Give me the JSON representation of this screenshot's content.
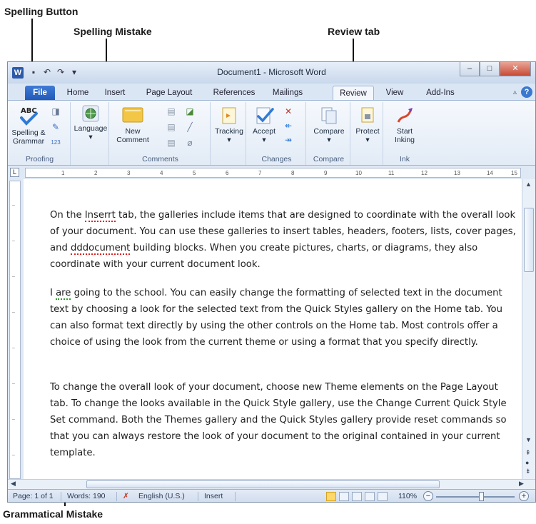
{
  "callouts": {
    "spelling_button": "Spelling Button",
    "spelling_mistake": "Spelling Mistake",
    "review_tab": "Review tab",
    "grammatical_mistake": "Grammatical Mistake"
  },
  "window": {
    "app_icon_letter": "W",
    "title": "Document1 - Microsoft Word"
  },
  "tabs": [
    "File",
    "Home",
    "Insert",
    "Page Layout",
    "References",
    "Mailings",
    "Review",
    "View",
    "Add-Ins"
  ],
  "active_tab": "Review",
  "ribbon": {
    "proofing": {
      "spelling_line1": "Spelling &",
      "spelling_line2": "Grammar",
      "group_label": "Proofing"
    },
    "language": {
      "label": "Language",
      "dropdown": "▾"
    },
    "comments": {
      "new_comment_line1": "New",
      "new_comment_line2": "Comment",
      "group_label": "Comments"
    },
    "tracking": {
      "label": "Tracking",
      "dropdown": "▾"
    },
    "changes": {
      "accept_label": "Accept",
      "dropdown": "▾",
      "group_label": "Changes"
    },
    "compare": {
      "compare_label": "Compare",
      "dropdown": "▾",
      "group_label": "Compare"
    },
    "protect": {
      "label": "Protect",
      "dropdown": "▾"
    },
    "ink": {
      "start_inking_line1": "Start",
      "start_inking_line2": "Inking",
      "group_label": "Ink"
    }
  },
  "ruler_numbers": [
    "1",
    "2",
    "3",
    "4",
    "5",
    "6",
    "7",
    "8",
    "9",
    "10",
    "11",
    "12",
    "13",
    "14",
    "15"
  ],
  "document": {
    "p1": {
      "before": "On the ",
      "misspelled": "Inserrt",
      "mid": " tab, the galleries include items that are designed to coordinate with the overall look of your document. You can use these galleries to insert tables, headers, footers, lists, cover pages, and ",
      "misspelled2": "dddocument",
      "after": " building blocks. When you create pictures, charts, or diagrams, they also coordinate with your current document look."
    },
    "p2": {
      "before": "I ",
      "grammar_error": "are",
      "after": " going to the school. You can easily change the formatting of selected text in the document text by choosing a look for the selected text from the Quick Styles gallery on the Home tab. You can also format text directly by using the other controls on the Home tab. Most controls offer a choice of using the look from the current theme or using a format that you specify directly."
    },
    "p3": "To change the overall look of your document, choose new Theme elements on the Page Layout tab. To change the looks available in the Quick Style gallery, use the Change Current Quick Style Set command. Both the Themes gallery and the Quick Styles gallery provide reset commands so that you can always restore the look of your document to the original contained in your current template."
  },
  "statusbar": {
    "page": "Page: 1 of 1",
    "words": "Words: 190",
    "language": "English (U.S.)",
    "mode": "Insert",
    "zoom": "110%",
    "zoom_out": "−",
    "zoom_in": "+"
  },
  "icons": {
    "spelling": "spelling-check-icon",
    "language": "globe-icon",
    "new_comment": "comment-icon",
    "tracking": "track-changes-icon",
    "accept": "accept-change-icon",
    "compare": "compare-icon",
    "protect": "protect-document-icon",
    "ink": "pen-icon",
    "proofing_status": "proofing-error-icon"
  },
  "colors": {
    "file_tab": "#2058b6",
    "spelling_underline": "#e02020",
    "grammar_underline": "#2a9a2a",
    "close_button": "#c74a34"
  }
}
